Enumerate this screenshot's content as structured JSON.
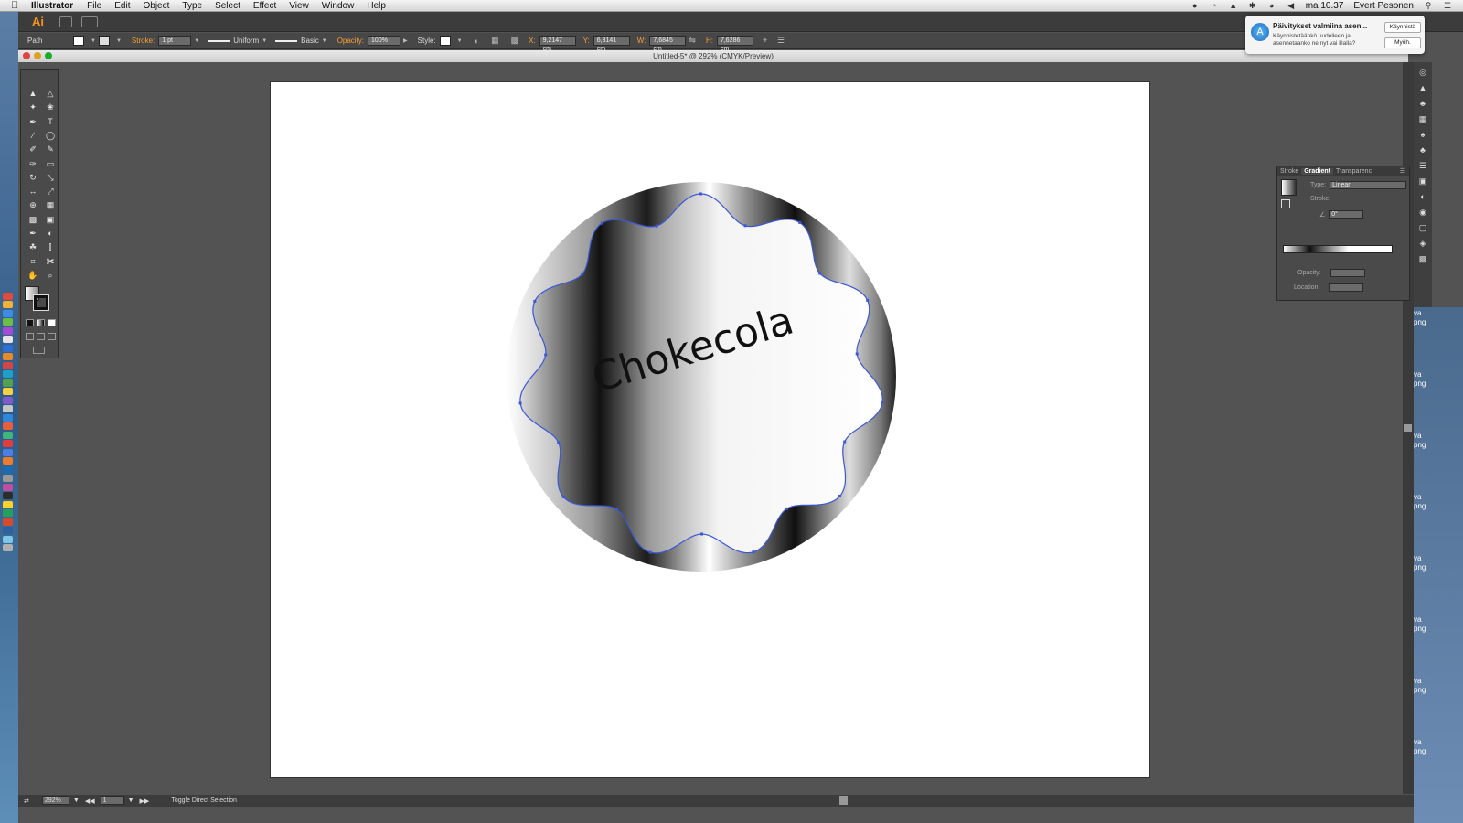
{
  "menubar": {
    "app_name": "Illustrator",
    "items": [
      "File",
      "Edit",
      "Object",
      "Type",
      "Select",
      "Effect",
      "View",
      "Window",
      "Help"
    ],
    "clock": "ma 10.37",
    "user": "Evert Pesonen"
  },
  "appbar": {
    "logo": "Ai",
    "bridge": "Br"
  },
  "controlbar": {
    "object_type": "Path",
    "stroke_label": "Stroke:",
    "stroke_weight": "1 pt",
    "stroke_profile": "Uniform",
    "brush": "Basic",
    "opacity_label": "Opacity:",
    "opacity": "100%",
    "style_label": "Style:",
    "x_label": "X:",
    "x": "9,2147 cm",
    "y_label": "Y:",
    "y": "6,3141 cm",
    "w_label": "W:",
    "w": "7,6845 cm",
    "h_label": "H:",
    "h": "7,6286 cm"
  },
  "document": {
    "title": "Untitled-5* @ 292% (CMYK/Preview)",
    "artwork_text": "Chokecola"
  },
  "gradient_panel": {
    "tabs": [
      "Stroke",
      "Gradient",
      "Transparenc"
    ],
    "active_tab": "Gradient",
    "type_label": "Type:",
    "type_value": "Linear",
    "stroke_label": "Stroke:",
    "angle": "0°",
    "opacity_label": "Opacity:",
    "location_label": "Location:"
  },
  "notification": {
    "title": "Päivitykset valmiina asen...",
    "body": "Käynnistetäänkö uudelleen ja asennetaanko ne nyt vai illalla?",
    "primary_button": "Käynnistä",
    "secondary_button": "Myöh."
  },
  "statusbar": {
    "zoom": "292%",
    "artboard_number": "1",
    "tool_hint": "Toggle Direct Selection"
  },
  "desktop_labels": [
    "va",
    "png",
    "va",
    "png",
    "va",
    "png",
    "va",
    "png",
    "va",
    "png",
    "va",
    "png",
    "va",
    "png",
    "va",
    "png"
  ],
  "colors": {
    "accent_orange": "#f7921e",
    "selection_blue": "#3a57d6"
  }
}
